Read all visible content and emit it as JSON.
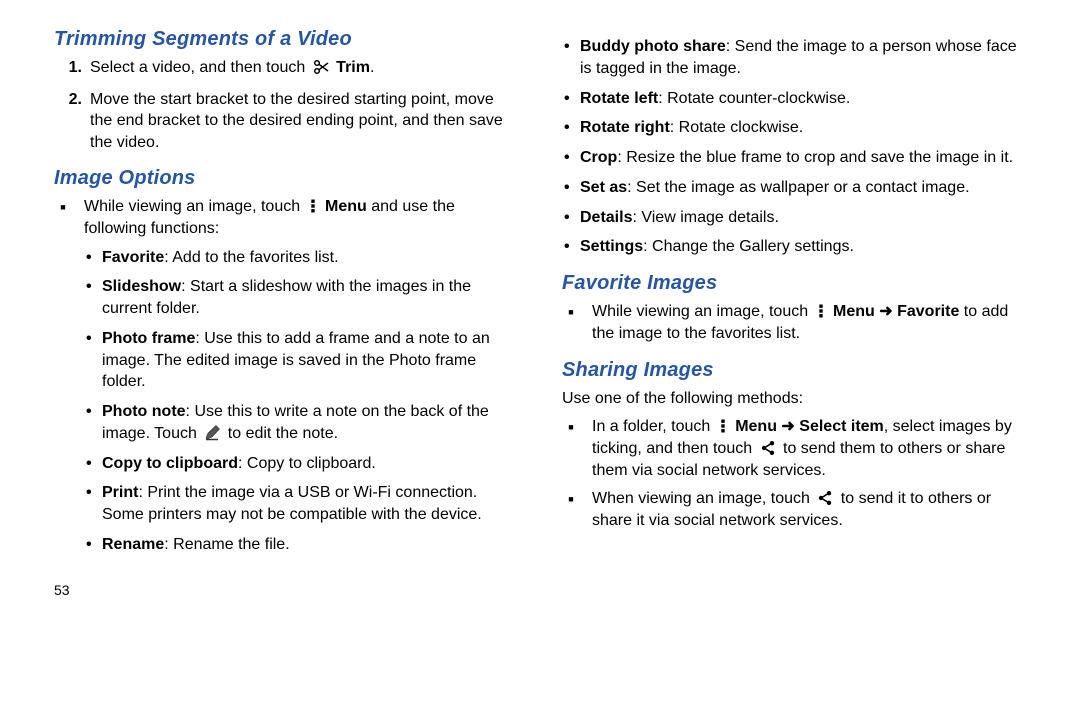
{
  "left": {
    "h1": "Trimming Segments of a Video",
    "step1_pre": "Select a video, and then touch ",
    "step1_trim": "Trim",
    "step1_post": ".",
    "step2": "Move the start bracket to the desired starting point, move the end bracket to the desired ending point, and then save the video.",
    "h2": "Image Options",
    "intro_pre": "While viewing an image, touch ",
    "intro_menu": "Menu",
    "intro_post": " and use the following functions:",
    "fav_b": "Favorite",
    "fav_t": ": Add to the favorites list.",
    "slide_b": "Slideshow",
    "slide_t": ": Start a slideshow with the images in the current folder.",
    "pf_b": "Photo frame",
    "pf_t": ": Use this to add a frame and a note to an image. The edited image is saved in the Photo frame folder.",
    "pn_b": "Photo note",
    "pn_t1": ": Use this to write a note on the back of the image. Touch ",
    "pn_t2": " to edit the note.",
    "clip_b": "Copy to clipboard",
    "clip_t": ": Copy to clipboard.",
    "print_b": "Print",
    "print_t": ": Print the image via a USB or Wi-Fi connection. Some printers may not be compatible with the device.",
    "ren_b": "Rename",
    "ren_t": ": Rename the file.",
    "page": "53"
  },
  "right": {
    "bps_b": "Buddy photo share",
    "bps_t": ": Send the image to a person whose face is tagged in the image.",
    "rl_b": "Rotate left",
    "rl_t": ": Rotate counter-clockwise.",
    "rr_b": "Rotate right",
    "rr_t": ": Rotate clockwise.",
    "crop_b": "Crop",
    "crop_t": ": Resize the blue frame to crop and save the image in it.",
    "set_b": "Set as",
    "set_t": ": Set the image as wallpaper or a contact image.",
    "det_b": "Details",
    "det_t": ": View image details.",
    "setg_b": "Settings",
    "setg_t": ": Change the Gallery settings.",
    "h3": "Favorite Images",
    "fav_pre": "While viewing an image, touch ",
    "fav_menu": "Menu",
    "fav_arrow": " ➜ ",
    "fav_fav": "Favorite",
    "fav_post": " to add the image to the favorites list.",
    "h4": "Sharing Images",
    "sh_intro": "Use one of the following methods:",
    "sh1_pre": "In a folder, touch ",
    "sh1_menu": "Menu",
    "sh1_arrow": " ➜ ",
    "sh1_sel": "Select item",
    "sh1_mid": ", select images by ticking, and then touch ",
    "sh1_post": " to send them to others or share them via social network services.",
    "sh2_pre": "When viewing an image, touch ",
    "sh2_post": " to send it to others or share it via social network services."
  }
}
